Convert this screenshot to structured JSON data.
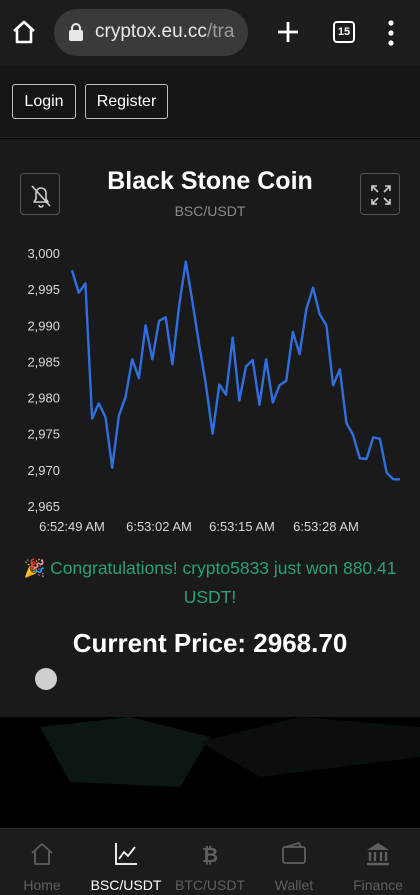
{
  "browser": {
    "url_main": "cryptox.eu.cc",
    "url_rest": "/tra",
    "tab_count": "15"
  },
  "auth": {
    "login_label": "Login",
    "register_label": "Register"
  },
  "card": {
    "title": "Black Stone Coin",
    "pair": "BSC/USDT",
    "congrats": "🎉 Congratulations! crypto5833 just won 880.41 USDT!",
    "current_price": "Current Price: 2968.70"
  },
  "chart_data": {
    "type": "line",
    "title": "",
    "xlabel": "",
    "ylabel": "",
    "ylim": [
      2965,
      3000
    ],
    "yticks": [
      "3,000",
      "2,995",
      "2,990",
      "2,985",
      "2,980",
      "2,975",
      "2,970",
      "2,965"
    ],
    "xticks": [
      "6:52:49 AM",
      "6:53:02 AM",
      "6:53:15 AM",
      "6:53:28 AM"
    ],
    "line_color": "#2f6fe0",
    "series": [
      {
        "values": [
          2997.6,
          2994.5,
          2995.8,
          2977.1,
          2979.2,
          2977.3,
          2970.3,
          2977.5,
          2980.1,
          2985.3,
          2982.7,
          2990.0,
          2985.3,
          2990.6,
          2991.1,
          2984.6,
          2992.7,
          2998.8,
          2993.2,
          2987.3,
          2981.8,
          2975.0,
          2981.8,
          2980.4,
          2988.3,
          2979.6,
          2984.3,
          2985.2,
          2979.0,
          2985.3,
          2979.3,
          2981.7,
          2982.3,
          2989.1,
          2986.0,
          2992.2,
          2995.2,
          2991.5,
          2990.0,
          2981.7,
          2983.9,
          2976.5,
          2974.8,
          2971.6,
          2971.5,
          2974.5,
          2974.3,
          2969.6,
          2968.7,
          2968.7
        ]
      }
    ]
  },
  "nav": {
    "items": [
      {
        "label": "Home"
      },
      {
        "label": "BSC/USDT"
      },
      {
        "label": "BTC/USDT"
      },
      {
        "label": "Wallet"
      },
      {
        "label": "Finance"
      }
    ]
  }
}
